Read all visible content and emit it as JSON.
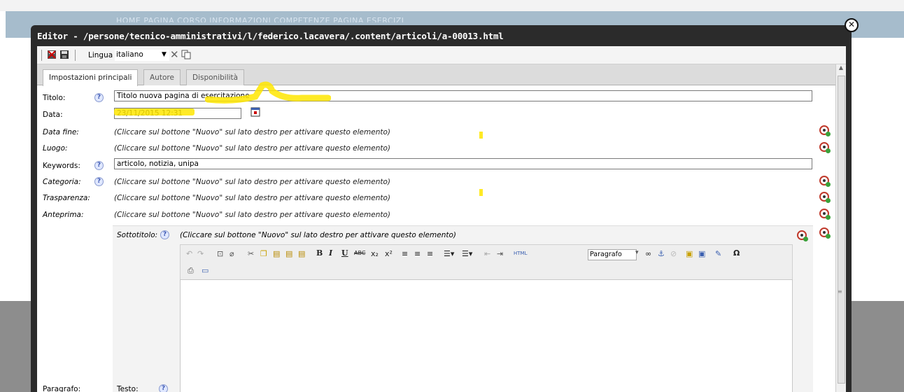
{
  "background_nav": "HOME   PAGINA CORSO   INFORMAZIONI   COMPETENZE   PAGINA ESERCIZI",
  "window": {
    "title": "Editor - /persone/tecnico-amministrativi/l/federico.lacavera/.content/articoli/a-00013.html",
    "close_icon": "close-icon"
  },
  "toolbar": {
    "language_label": "Lingua",
    "language_value": "italiano"
  },
  "tabs": [
    {
      "label": "Impostazioni principali"
    },
    {
      "label": "Autore"
    },
    {
      "label": "Disponibilità"
    }
  ],
  "form": {
    "title_label": "Titolo:",
    "title_value": "Titolo nuova pagina di esercitazione",
    "date_label": "Data:",
    "date_value": "23/11/2015 12:31",
    "data_fine_label": "Data fine:",
    "luogo_label": "Luogo:",
    "keywords_label": "Keywords:",
    "keywords_value": "articolo, notizia, unipa",
    "categoria_label": "Categoria:",
    "trasparenza_label": "Trasparenza:",
    "anteprima_label": "Anteprima:",
    "hint": "(Cliccare sul bottone \"Nuovo\" sul lato destro per attivare questo elemento)",
    "help": "?"
  },
  "paragrafo": {
    "sottotitolo_label": "Sottotitolo:",
    "hint": "(Cliccare sul bottone \"Nuovo\" sul lato destro per attivare questo elemento)",
    "format_value": "Paragrafo",
    "paragrafo_label": "Paragrafo:",
    "testo_label": "Testo:"
  },
  "colors": {
    "window_bg": "#2b2b2b",
    "nav_bg": "#a6bccc",
    "highlight": "#ffe600",
    "new_button": "#c0392b"
  }
}
